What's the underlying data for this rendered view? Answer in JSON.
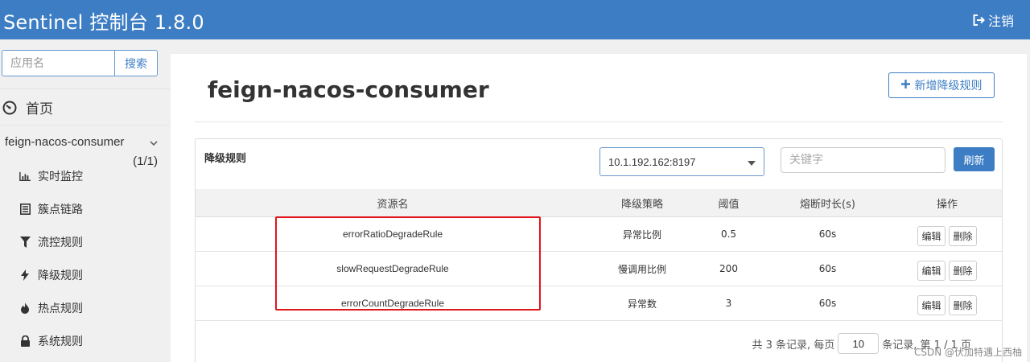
{
  "header": {
    "brand": "Sentinel 控制台 1.8.0",
    "logout_label": "注销",
    "bg_color": "#3c7dc4"
  },
  "sidebar": {
    "search_placeholder": "应用名",
    "search_button": "搜索",
    "home_label": "首页",
    "app": {
      "name": "feign-nacos-consumer",
      "count": "(1/1)"
    },
    "items": [
      {
        "label": "实时监控",
        "icon": "bar-chart-icon"
      },
      {
        "label": "簇点链路",
        "icon": "list-icon"
      },
      {
        "label": "流控规则",
        "icon": "filter-icon"
      },
      {
        "label": "降级规则",
        "icon": "bolt-icon"
      },
      {
        "label": "热点规则",
        "icon": "fire-icon"
      },
      {
        "label": "系统规则",
        "icon": "lock-icon"
      }
    ]
  },
  "main": {
    "title": "feign-nacos-consumer",
    "add_button": "新增降级规则",
    "card_title": "降级规则",
    "machine_select": "10.1.192.162:8197",
    "keyword_placeholder": "关键字",
    "refresh_button": "刷新",
    "columns": [
      "资源名",
      "降级策略",
      "阈值",
      "熔断时长(s)",
      "操作"
    ],
    "rows": [
      {
        "resource": "errorRatioDegradeRule",
        "strategy": "异常比例",
        "threshold": "0.5",
        "duration": "60s"
      },
      {
        "resource": "slowRequestDegradeRule",
        "strategy": "慢调用比例",
        "threshold": "200",
        "duration": "60s"
      },
      {
        "resource": "errorCountDegradeRule",
        "strategy": "异常数",
        "threshold": "3",
        "duration": "60s"
      }
    ],
    "edit_label": "编辑",
    "delete_label": "删除",
    "pager": {
      "prefix": "共 3 条记录, 每页",
      "page_size": "10",
      "suffix": "条记录, 第 1 / 1 页"
    }
  },
  "watermark": "CSDN @伏加特遇上西柚",
  "colors": {
    "accent": "#3c7dc4",
    "highlight_box": "#e0151a"
  }
}
